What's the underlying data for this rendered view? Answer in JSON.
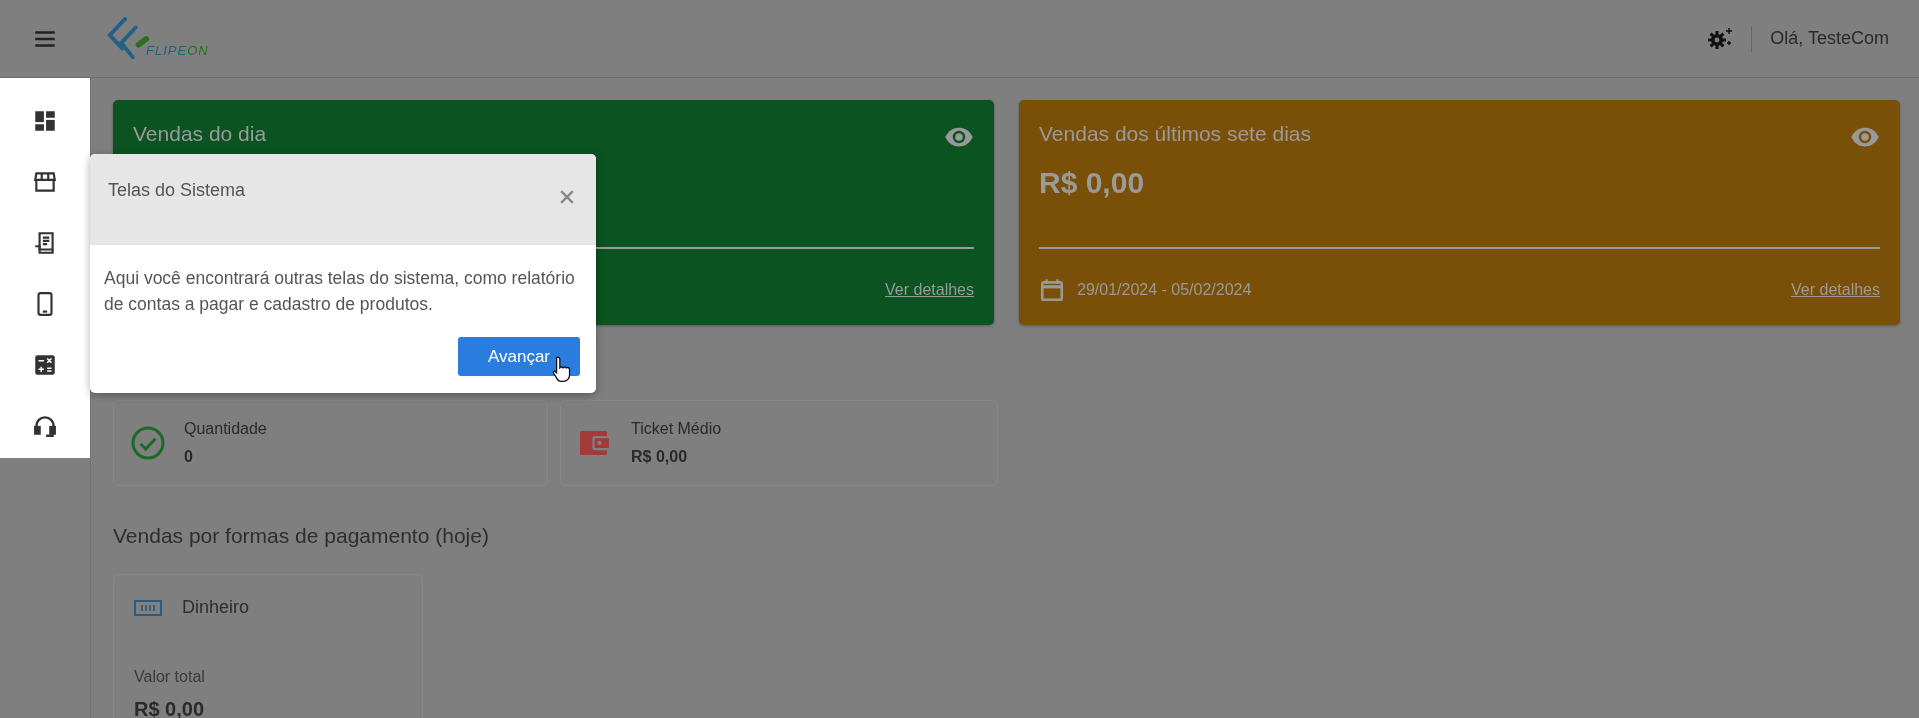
{
  "header": {
    "logo": {
      "main": "FLIPE",
      "accent": "ON"
    },
    "greeting": "Olá, TesteCom"
  },
  "sidebar": {
    "items": [
      {
        "kind": "dashboard"
      },
      {
        "kind": "store"
      },
      {
        "kind": "receipt"
      },
      {
        "kind": "phone"
      },
      {
        "kind": "calculator"
      },
      {
        "kind": "headset"
      }
    ]
  },
  "summary_cards": [
    {
      "title": "Vendas do dia",
      "link": "Ver detalhes",
      "color": "#0b5320"
    },
    {
      "title": "Vendas dos últimos sete dias",
      "value": "R$ 0,00",
      "date_range": "29/01/2024 - 05/02/2024",
      "link": "Ver detalhes",
      "color": "#7a4f08"
    }
  ],
  "stats": [
    {
      "kind": "count",
      "label": "Quantidade",
      "value": "0"
    },
    {
      "kind": "ticket",
      "label": "Ticket Médio",
      "value": "R$ 0,00"
    }
  ],
  "payments": {
    "heading": "Vendas por formas de pagamento (hoje)",
    "cards": [
      {
        "kind": "cash",
        "name": "Dinheiro",
        "total_label": "Valor total",
        "total": "R$ 0,00"
      }
    ]
  },
  "tour_popover": {
    "title": "Telas do Sistema",
    "text": "Aqui você encontrará outras telas do sistema, como relatório de contas a pagar e cadastro de produtos.",
    "button": "Avançar"
  }
}
